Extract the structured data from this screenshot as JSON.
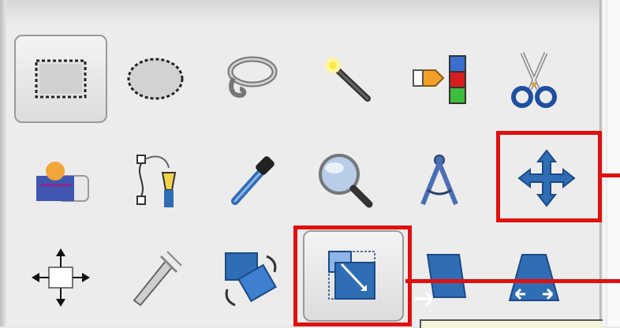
{
  "toolbox": {
    "tools": [
      {
        "name": "rectangle-select",
        "icon": "rectangle-select-icon",
        "active": true
      },
      {
        "name": "ellipse-select",
        "icon": "ellipse-select-icon"
      },
      {
        "name": "free-select",
        "icon": "lasso-icon"
      },
      {
        "name": "fuzzy-select",
        "icon": "magic-wand-icon"
      },
      {
        "name": "select-by-color",
        "icon": "color-select-icon"
      },
      {
        "name": "scissors-select",
        "icon": "scissors-icon"
      },
      {
        "name": "foreground-select",
        "icon": "foreground-select-icon"
      },
      {
        "name": "paths",
        "icon": "pen-path-icon"
      },
      {
        "name": "color-picker",
        "icon": "eyedropper-icon"
      },
      {
        "name": "zoom",
        "icon": "magnifier-icon"
      },
      {
        "name": "measure",
        "icon": "compass-icon"
      },
      {
        "name": "move",
        "icon": "move-arrows-icon",
        "highlighted": true
      },
      {
        "name": "alignment",
        "icon": "align-icon"
      },
      {
        "name": "crop",
        "icon": "crop-knife-icon"
      },
      {
        "name": "rotate",
        "icon": "rotate-icon"
      },
      {
        "name": "scale",
        "icon": "scale-icon",
        "highlighted": true,
        "hovered": true
      },
      {
        "name": "shear",
        "icon": "shear-icon"
      },
      {
        "name": "perspective",
        "icon": "perspective-icon"
      }
    ],
    "highlight_color": "#e01010",
    "icon_blue": "#2f6db5"
  }
}
